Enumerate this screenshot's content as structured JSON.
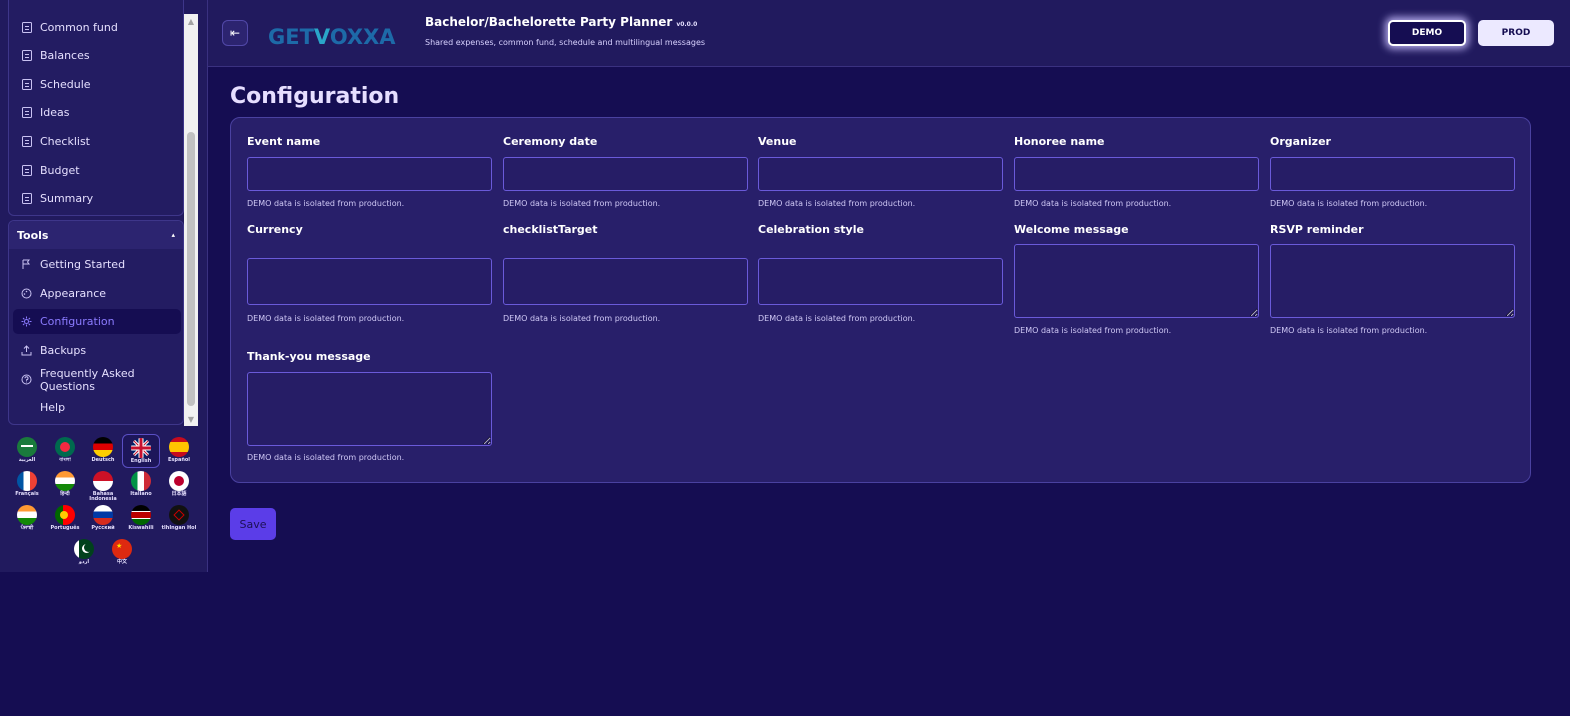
{
  "sidebar": {
    "top_items": [
      {
        "label": "Common fund",
        "icon": "document-icon"
      },
      {
        "label": "Balances",
        "icon": "document-icon"
      },
      {
        "label": "Schedule",
        "icon": "document-icon"
      },
      {
        "label": "Ideas",
        "icon": "document-icon"
      },
      {
        "label": "Checklist",
        "icon": "document-icon"
      },
      {
        "label": "Budget",
        "icon": "document-icon"
      },
      {
        "label": "Summary",
        "icon": "document-icon"
      }
    ],
    "tools_header": "Tools",
    "tools_toggle": "▴",
    "tools_items": [
      {
        "label": "Getting Started",
        "icon": "flag-start-icon"
      },
      {
        "label": "Appearance",
        "icon": "palette-icon"
      },
      {
        "label": "Configuration",
        "icon": "gear-icon",
        "active": true
      },
      {
        "label": "Backups",
        "icon": "upload-icon"
      },
      {
        "label": "Frequently Asked Questions",
        "icon": "question-icon"
      },
      {
        "label": "Help",
        "icon": ""
      }
    ]
  },
  "languages": [
    {
      "label": "العربية",
      "flag": "sa"
    },
    {
      "label": "বাংলা",
      "flag": "bd"
    },
    {
      "label": "Deutsch",
      "flag": "de"
    },
    {
      "label": "English",
      "flag": "gb",
      "active": true
    },
    {
      "label": "Español",
      "flag": "es"
    },
    {
      "label": "Français",
      "flag": "fr"
    },
    {
      "label": "हिन्दी",
      "flag": "in"
    },
    {
      "label": "Bahasa Indonesia",
      "flag": "id"
    },
    {
      "label": "Italiano",
      "flag": "it"
    },
    {
      "label": "日本語",
      "flag": "jp"
    },
    {
      "label": "ਪੰਜਾਬੀ",
      "flag": "in2"
    },
    {
      "label": "Português",
      "flag": "pt"
    },
    {
      "label": "Русский",
      "flag": "ru"
    },
    {
      "label": "Kiswahili",
      "flag": "ke"
    },
    {
      "label": "tlhIngan Hol",
      "flag": "kl"
    },
    {
      "label": "اردو",
      "flag": "pk"
    },
    {
      "label": "中文",
      "flag": "cn"
    }
  ],
  "header": {
    "logo_text_1": "GET",
    "logo_text_check": "V",
    "logo_text_2": "OXXA",
    "title": "Bachelor/Bachelorette Party Planner",
    "version": "v0.0.0",
    "subtitle": "Shared expenses, common fund, schedule and multilingual messages",
    "demo_label": "DEMO",
    "prod_label": "PROD",
    "collapse_icon": "⇤"
  },
  "page": {
    "title": "Configuration",
    "save_label": "Save",
    "hint": "DEMO data is isolated from production."
  },
  "fields": [
    {
      "label": "Event name",
      "value": ""
    },
    {
      "label": "Ceremony date",
      "value": ""
    },
    {
      "label": "Venue",
      "value": ""
    },
    {
      "label": "Honoree name",
      "value": ""
    },
    {
      "label": "Organizer",
      "value": ""
    },
    {
      "label": "Currency",
      "value": ""
    },
    {
      "label": "checklistTarget",
      "value": ""
    },
    {
      "label": "Celebration style",
      "value": ""
    },
    {
      "label": "Welcome message",
      "value": ""
    },
    {
      "label": "RSVP reminder",
      "value": ""
    },
    {
      "label": "Thank-you message",
      "value": ""
    }
  ],
  "colors": {
    "background": "#150d52",
    "panel": "#211a5e",
    "accent": "#5b3de8",
    "active_nav": "#8b7bff"
  }
}
